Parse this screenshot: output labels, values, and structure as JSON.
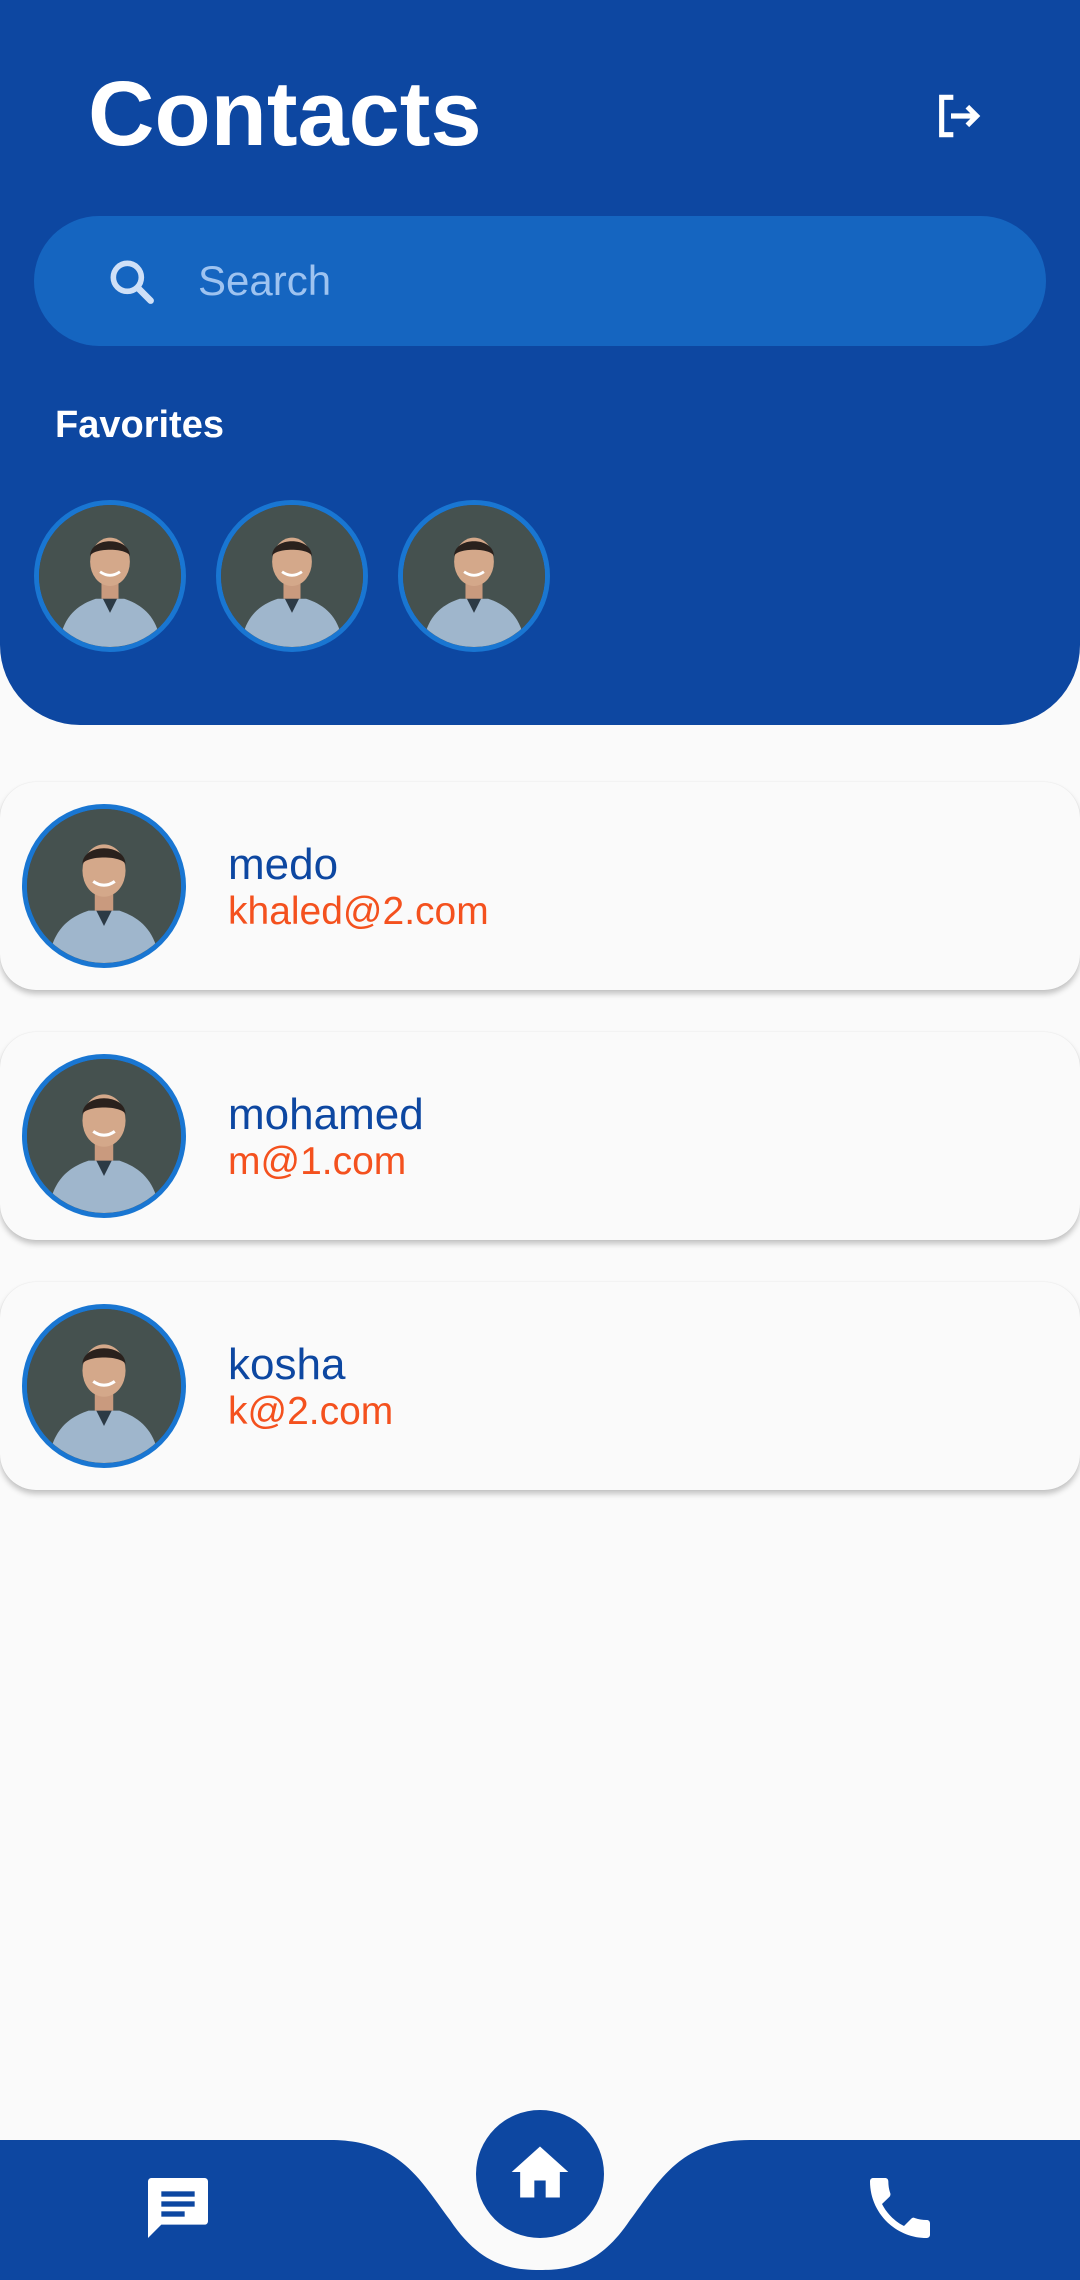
{
  "header": {
    "title": "Contacts",
    "logout_icon": "logout-icon"
  },
  "search": {
    "placeholder": "Search",
    "value": "",
    "icon": "search-icon"
  },
  "favorites": {
    "label": "Favorites",
    "count": 3
  },
  "contacts": [
    {
      "name": "medo",
      "email": "khaled@2.com"
    },
    {
      "name": "mohamed",
      "email": "m@1.com"
    },
    {
      "name": "kosha",
      "email": "k@2.com"
    }
  ],
  "bottom_nav": {
    "items": [
      "chat-icon",
      "home-icon",
      "phone-icon"
    ]
  },
  "colors": {
    "primary": "#0D47A1",
    "search_bg": "#1565C0",
    "accent": "#F4511E",
    "background": "#FAFAFA"
  }
}
